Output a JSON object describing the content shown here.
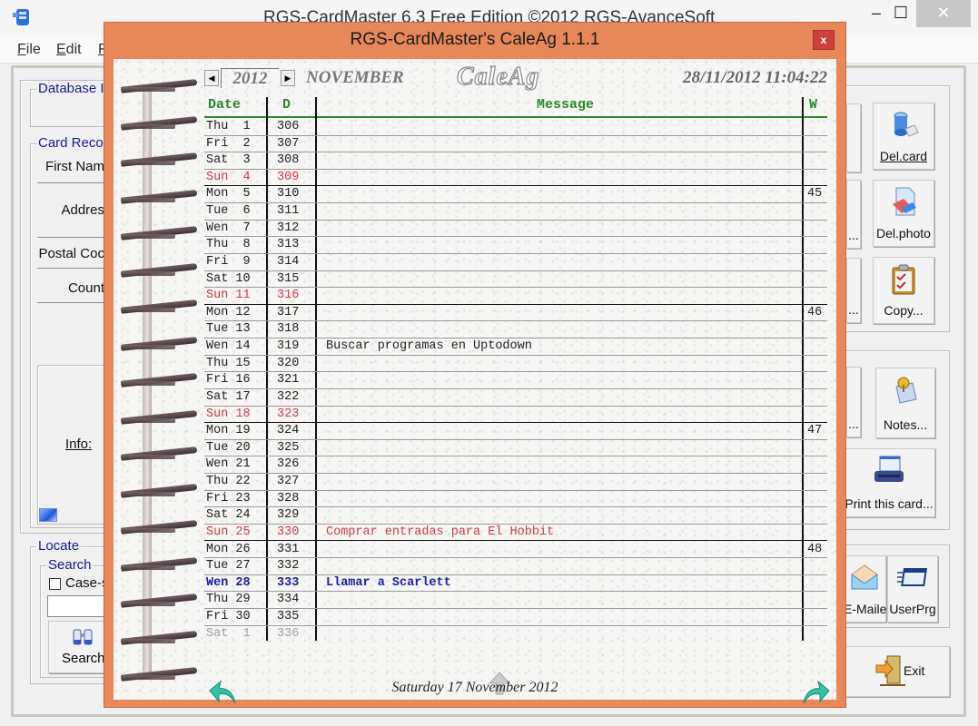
{
  "main_window": {
    "title": "RGS-CardMaster 6.3 Free Edition ©2012 RGS-AvanceSoft",
    "controls": {
      "minimize": "–",
      "maximize": "☐",
      "close": "✕"
    },
    "menu": [
      {
        "label": "File",
        "accel": "F",
        "rest": "ile"
      },
      {
        "label": "Edit",
        "accel": "E",
        "rest": "dit"
      },
      {
        "label": "F",
        "accel": "F",
        "rest": ""
      }
    ],
    "left_panel": {
      "database_group": "Database In",
      "card_group": "Card Record",
      "fields": [
        "First Nam",
        "Addres",
        "Postal Coc",
        "Count"
      ],
      "info_label": "Info:",
      "locate_group": "Locate",
      "search_group": "Search",
      "case_checkbox_label": "Case-s",
      "case_checked": false,
      "search_value": "",
      "search_button": "Search"
    },
    "right_panel": {
      "buttons": [
        {
          "label": "Del.card",
          "icon": "delete-card-icon"
        },
        {
          "label": "Del.photo",
          "icon": "delete-photo-icon"
        },
        {
          "label": "Copy...",
          "icon": "clipboard-icon"
        },
        {
          "label": "Notes...",
          "icon": "notes-pin-icon"
        },
        {
          "label": "Print this card...",
          "icon": "printer-icon"
        },
        {
          "label": "E-Mailer",
          "icon": "envelope-icon"
        },
        {
          "label": "UserPrg",
          "icon": "user-program-icon"
        },
        {
          "label": "Exit",
          "icon": "exit-door-icon"
        }
      ],
      "partial_labels": [
        "...",
        "...",
        "..."
      ]
    }
  },
  "dialog": {
    "title": "RGS-CardMaster's CaleAg 1.1.1",
    "close": "x",
    "year": "2012",
    "month": "NOVEMBER",
    "logo": "CaleAg",
    "datetime": "28/11/2012 11:04:22",
    "columns": {
      "date": "Date",
      "doy": "D",
      "message": "Message",
      "week": "W"
    },
    "rows": [
      {
        "day": "Thu  1",
        "doy": "306",
        "msg": "",
        "wk": "",
        "type": "normal"
      },
      {
        "day": "Fri  2",
        "doy": "307",
        "msg": "",
        "wk": "",
        "type": "normal"
      },
      {
        "day": "Sat  3",
        "doy": "308",
        "msg": "",
        "wk": "",
        "type": "normal"
      },
      {
        "day": "Sun  4",
        "doy": "309",
        "msg": "",
        "wk": "",
        "type": "sunday"
      },
      {
        "day": "Mon  5",
        "doy": "310",
        "msg": "",
        "wk": "45",
        "type": "normal"
      },
      {
        "day": "Tue  6",
        "doy": "311",
        "msg": "",
        "wk": "",
        "type": "normal"
      },
      {
        "day": "Wen  7",
        "doy": "312",
        "msg": "",
        "wk": "",
        "type": "normal"
      },
      {
        "day": "Thu  8",
        "doy": "313",
        "msg": "",
        "wk": "",
        "type": "normal"
      },
      {
        "day": "Fri  9",
        "doy": "314",
        "msg": "",
        "wk": "",
        "type": "normal"
      },
      {
        "day": "Sat 10",
        "doy": "315",
        "msg": "",
        "wk": "",
        "type": "normal"
      },
      {
        "day": "Sun 11",
        "doy": "316",
        "msg": "",
        "wk": "",
        "type": "sunday"
      },
      {
        "day": "Mon 12",
        "doy": "317",
        "msg": "",
        "wk": "46",
        "type": "normal"
      },
      {
        "day": "Tue 13",
        "doy": "318",
        "msg": "",
        "wk": "",
        "type": "normal"
      },
      {
        "day": "Wen 14",
        "doy": "319",
        "msg": "Buscar programas en Uptodown",
        "wk": "",
        "type": "normal"
      },
      {
        "day": "Thu 15",
        "doy": "320",
        "msg": "",
        "wk": "",
        "type": "normal"
      },
      {
        "day": "Fri 16",
        "doy": "321",
        "msg": "",
        "wk": "",
        "type": "normal"
      },
      {
        "day": "Sat 17",
        "doy": "322",
        "msg": "",
        "wk": "",
        "type": "normal"
      },
      {
        "day": "Sun 18",
        "doy": "323",
        "msg": "",
        "wk": "",
        "type": "sunday"
      },
      {
        "day": "Mon 19",
        "doy": "324",
        "msg": "",
        "wk": "47",
        "type": "normal"
      },
      {
        "day": "Tue 20",
        "doy": "325",
        "msg": "",
        "wk": "",
        "type": "normal"
      },
      {
        "day": "Wen 21",
        "doy": "326",
        "msg": "",
        "wk": "",
        "type": "normal"
      },
      {
        "day": "Thu 22",
        "doy": "327",
        "msg": "",
        "wk": "",
        "type": "normal"
      },
      {
        "day": "Fri 23",
        "doy": "328",
        "msg": "",
        "wk": "",
        "type": "normal"
      },
      {
        "day": "Sat 24",
        "doy": "329",
        "msg": "",
        "wk": "",
        "type": "normal"
      },
      {
        "day": "Sun 25",
        "doy": "330",
        "msg": "Comprar entradas para El Hobbit",
        "wk": "",
        "type": "sunday"
      },
      {
        "day": "Mon 26",
        "doy": "331",
        "msg": "",
        "wk": "48",
        "type": "normal"
      },
      {
        "day": "Tue 27",
        "doy": "332",
        "msg": "",
        "wk": "",
        "type": "normal"
      },
      {
        "day": "Wen 28",
        "doy": "333",
        "msg": "Llamar a Scarlett",
        "wk": "",
        "type": "today"
      },
      {
        "day": "Thu 29",
        "doy": "334",
        "msg": "",
        "wk": "",
        "type": "normal"
      },
      {
        "day": "Fri 30",
        "doy": "335",
        "msg": "",
        "wk": "",
        "type": "normal"
      },
      {
        "day": "Sat  1",
        "doy": "336",
        "msg": "",
        "wk": "",
        "type": "other"
      }
    ],
    "footer_date": "Saturday 17 November 2012",
    "colors": {
      "frame": "#e8875a",
      "header_green": "#2a8a2a",
      "sunday_red": "#d43a4a",
      "today_blue": "#2020a8",
      "nav_arrow": "#2fc4a8"
    }
  }
}
